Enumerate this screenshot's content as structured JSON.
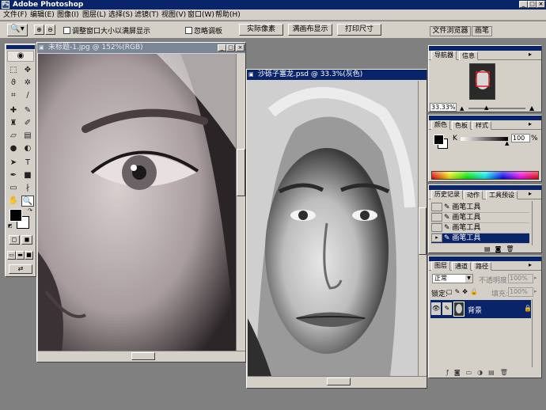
{
  "app": {
    "title": "Adobe Photoshop",
    "controls": [
      "_",
      "□",
      "×"
    ]
  },
  "menu": [
    "文件(F)",
    "编辑(E)",
    "图像(I)",
    "图层(L)",
    "选择(S)",
    "滤镜(T)",
    "视图(V)",
    "窗口(W)",
    "帮助(H)"
  ],
  "options": {
    "resize_label": "调整窗口大小以满屏显示",
    "ignore_palettes_label": "忽略调板",
    "actual_pixels": "实际像素",
    "fit_screen": "满画布显示",
    "print_size": "打印尺寸"
  },
  "dock_tabs": [
    "文件浏览器",
    "画笔"
  ],
  "doc1": {
    "title": "未标题-1.jpg @ 152%(RGB)"
  },
  "doc2": {
    "title": "沙砾子塞龙.psd @ 33.3%(灰色)"
  },
  "navigator": {
    "tabs": [
      "导航器",
      "信息"
    ],
    "zoom": "33.33%"
  },
  "color": {
    "tabs": [
      "颜色",
      "色板",
      "样式"
    ],
    "channel_label": "K",
    "value": "100",
    "unit": "%",
    "slider_value": 100
  },
  "history": {
    "tabs": [
      "历史记录",
      "动作",
      "工具预设"
    ],
    "items": [
      "画笔工具",
      "画笔工具",
      "画笔工具",
      "画笔工具"
    ]
  },
  "layers": {
    "tabs": [
      "图层",
      "通道",
      "路径"
    ],
    "blend_mode": "正常",
    "opacity_label": "不透明度:",
    "opacity": "100%",
    "lock_label": "锁定:",
    "fill_label": "填充:",
    "fill": "100%",
    "layer_name": "背景"
  },
  "colors": {
    "titlebar": "#0a246a",
    "chrome": "#d4d0c8",
    "workspace": "#808080"
  }
}
